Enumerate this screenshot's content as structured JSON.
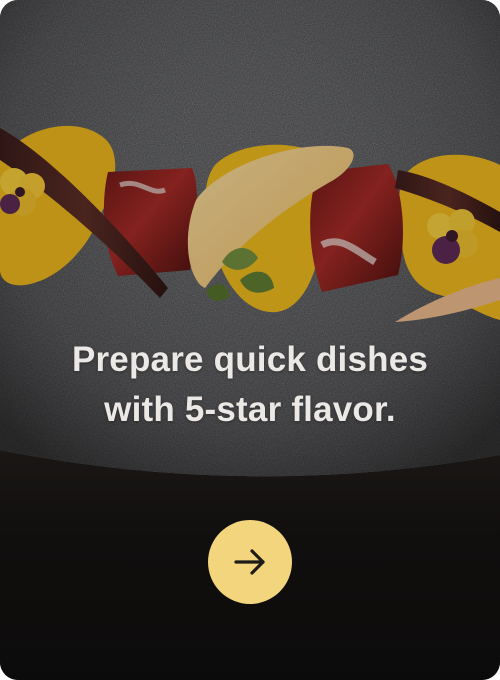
{
  "onboarding": {
    "headline_line1": "Prepare quick dishes",
    "headline_line2": "with 5-star flavor.",
    "next_button_icon": "arrow-right-icon"
  },
  "colors": {
    "accent": "#f2d57c",
    "headline_text": "#ebe8e5",
    "background_dark": "#0f0e0e"
  }
}
